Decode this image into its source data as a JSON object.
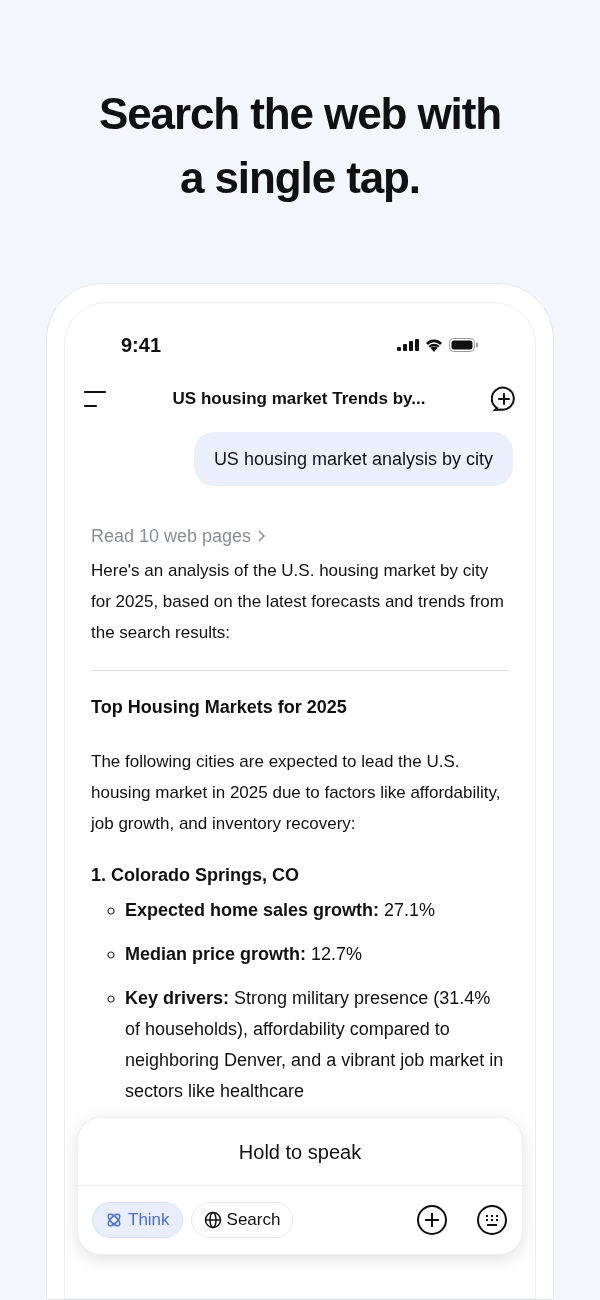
{
  "headline": "Search the web with a single tap.",
  "status_bar": {
    "time": "9:41"
  },
  "header": {
    "title": "US housing market Trends by..."
  },
  "user_message": "US housing market analysis by city",
  "sources_link": "Read 10 web pages",
  "intro": "Here's an analysis of the U.S. housing market by city for 2025, based on the latest forecasts and trends from the search results:",
  "section_heading": "Top Housing Markets for 2025",
  "section_text": "The following cities are expected to lead the U.S. housing market in 2025 due to factors like affordability, job growth, and inventory recovery:",
  "list_item": "1. Colorado Springs, CO",
  "bullets": [
    "**Expected home sales growth:** 27.1%",
    "**Median price growth:** 12.7%",
    "**Key drivers:** Strong military presence (31.4% of households), affordability compared to neighboring Denver, and a vibrant job market in sectors like healthcare"
  ],
  "composer": {
    "voice_label": "Hold to speak",
    "toggles": [
      {
        "kind": "think",
        "label": "Think",
        "selected": true
      },
      {
        "kind": "search",
        "label": "Search",
        "selected": false
      }
    ]
  }
}
